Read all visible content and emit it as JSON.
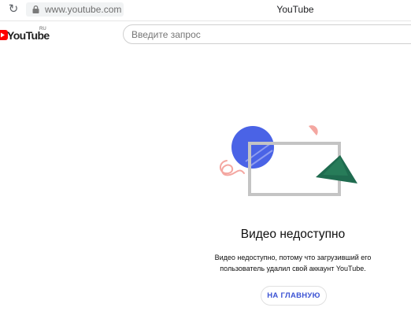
{
  "browser": {
    "url": "www.youtube.com",
    "tab_title": "YouTube",
    "reload_icon": "reload-icon",
    "lock_icon": "lock-icon"
  },
  "header": {
    "logo_text": "YouTube",
    "logo_region": "RU",
    "logo_icon": "youtube-play-icon",
    "search_placeholder": "Введите запрос",
    "brand_color": "#ff0000"
  },
  "error": {
    "title": "Видео недоступно",
    "message_line1": "Видео недоступно, потому что загрузивший его",
    "message_line2": "пользователь удалил свой аккаунт YouTube.",
    "home_button": "НА ГЛАВНУЮ",
    "button_color": "#3c53d4"
  },
  "illustration": {
    "colors": {
      "circle": "#4a63e6",
      "frame": "#c4c4c4",
      "triangle": "#1f6b4f",
      "accent": "#f4a7a1"
    }
  }
}
